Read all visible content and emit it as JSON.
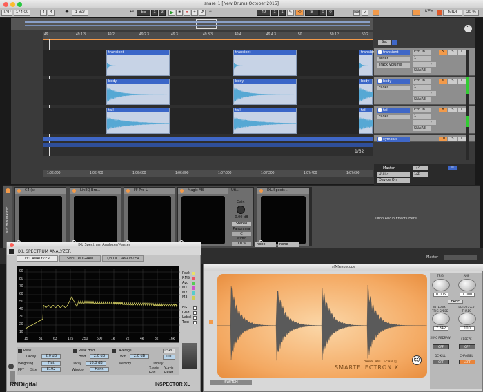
{
  "window": {
    "title": "snare_1  [New Drums October 2015]"
  },
  "toolbar": {
    "tap": "TAP",
    "tempo": "174.00",
    "meter_num": "4",
    "meter_den": "4",
    "quant": "1 Bar",
    "pos": "55",
    "pos2": "1",
    "pos3": "3",
    "loop_a": "49",
    "loop_b": "1",
    "loop_c": "1",
    "loop_d": "8",
    "loop_e": "0",
    "loop_f": "0",
    "key": "KEY",
    "midi": "MIDI",
    "cpu": "20 %"
  },
  "ruler_ticks": [
    "49",
    "49.1.3",
    "49.2",
    "49.2.3",
    "49.3",
    "49.3.3",
    "49.4",
    "49.4.3",
    "50",
    "50.1.3",
    "50.2"
  ],
  "time_ticks": [
    "1:06:200",
    "1:06:400",
    "1:06:600",
    "1:06:800",
    "1:07:000",
    "1:07:200",
    "1:07:400",
    "1:07:600"
  ],
  "arrangement": {
    "zoom": "1/32",
    "clip_names": [
      "transient",
      "body",
      "tail"
    ]
  },
  "tracks": [
    {
      "name": "transient",
      "sub": "Mixer",
      "sub2": "Track Volume",
      "input": "Ext. In",
      "ch": "1",
      "monitor": "Auto",
      "dest": "SNARE",
      "out": "Track In",
      "n1": "5",
      "n2": "S",
      "n3": "C"
    },
    {
      "name": "body",
      "sub": "Fades",
      "sub2": "",
      "input": "Ext. In",
      "ch": "1",
      "monitor": "Auto",
      "dest": "SNARE",
      "out": "Track In",
      "n1": "6",
      "n2": "S",
      "n3": "C"
    },
    {
      "name": "tail",
      "sub": "Fades",
      "sub2": "",
      "input": "Ext. In",
      "ch": "1",
      "monitor": "Auto",
      "dest": "SNARE",
      "out": "Track In",
      "n1": "8",
      "n2": "S",
      "n3": "C"
    },
    {
      "name": "cymbals",
      "sub": "",
      "sub2": "",
      "input": "",
      "ch": "",
      "monitor": "",
      "dest": "",
      "out": "",
      "n1": "10",
      "n2": "S",
      "n3": "C"
    }
  ],
  "master": {
    "name": "Master",
    "sub": "Utility",
    "sub2": "Device On",
    "in": "1/2",
    "out": "1/2",
    "n": "0"
  },
  "devices": {
    "labels": [
      "C4 (s)",
      "LinEQ Bro...",
      "FF Pro-L",
      "Magic AB",
      "Uti...",
      "IXL Spectr..."
    ],
    "utility": {
      "gain_label": "Gain",
      "gain": "0.00 dB",
      "mode": "Stereo",
      "panorama_label": "Panorama",
      "pan": "C",
      "width_label": "Width",
      "width": "0.0 %"
    },
    "drop_hint": "Drop Audio Effects Here",
    "sel_a": "none",
    "sel_b": "none",
    "sidebar": "Mix Bus Master",
    "master_label": "Master"
  },
  "inspector": {
    "window_title": "IXL Spectrum Analyzer/Master",
    "plugin_name": "IXL SPECTRUM ANALYZER",
    "tabs": [
      "FFT ANALYZER",
      "SPECTROGRAM",
      "1/3 OCT ANALYZER"
    ],
    "y_labels": [
      "90",
      "80",
      "70",
      "60",
      "50",
      "40",
      "30",
      "20",
      "10"
    ],
    "x_labels": [
      "15",
      "31",
      "63",
      "125",
      "250",
      "500",
      "1k",
      "2k",
      "4k",
      "8k",
      "16k"
    ],
    "peak_label": "Peak",
    "peak_decay_label": "Decay",
    "peak_decay": "2.0 dB",
    "peak_hold_label": "Peak Hold",
    "hold_label": "Hold",
    "hold": "2.0 dB",
    "weighting_label": "Weighting",
    "weighting": "Flat",
    "decay_label": "Decay",
    "decay": "16.0 dB",
    "fft_label": "FFT",
    "size_label": "Size",
    "size": "8192",
    "window_label": "Window",
    "window": "Hann",
    "average_label": "Average",
    "win_label": "Win",
    "win": "2.0 dB",
    "memory_label": "Memory",
    "display_label": "Display",
    "xaxis_label": "X-axis",
    "yaxis_label": "Y-axis",
    "grid_label": "Grid",
    "reset_label": "Reset",
    "side_labels": [
      "Peak",
      "RMS",
      "Avg",
      "M1",
      "M2",
      "M3"
    ],
    "bg_labels": [
      "BG",
      "Grid",
      "Label",
      "Text"
    ],
    "lsrc_label": "LSRC",
    "lsrc_val": "100",
    "brand": "RNDigital",
    "product": "INSPECTOR XL"
  },
  "sonoscope": {
    "window_title": "s(M)exoscope",
    "knobs": [
      {
        "label": "TRIG",
        "value": "0.005"
      },
      {
        "label": "AMP",
        "value": "1.000"
      },
      {
        "label": "INTERNAL TRIG SPEED",
        "value": "7.842"
      },
      {
        "label": "RETRIGGER THRES",
        "value": "100"
      }
    ],
    "free_label": "FREE",
    "sync_label": "SYNC REDRAW",
    "sync_state": "OFF",
    "freeze_label": "FREEZE",
    "freeze_state": "OFF",
    "dcfill_label": "DC-KILL",
    "dcfill_state": "OFF",
    "channel_label": "CHANNEL",
    "channel_state": "LEFT",
    "brand_line": "BRAM AND SEAN @",
    "brand": "SMARTELECTRONIX",
    "switch_label": "SWITCH"
  },
  "colors": {
    "accent": "#3f67c7",
    "orange": "#f29a4a",
    "clip": "#c7d3e6"
  }
}
